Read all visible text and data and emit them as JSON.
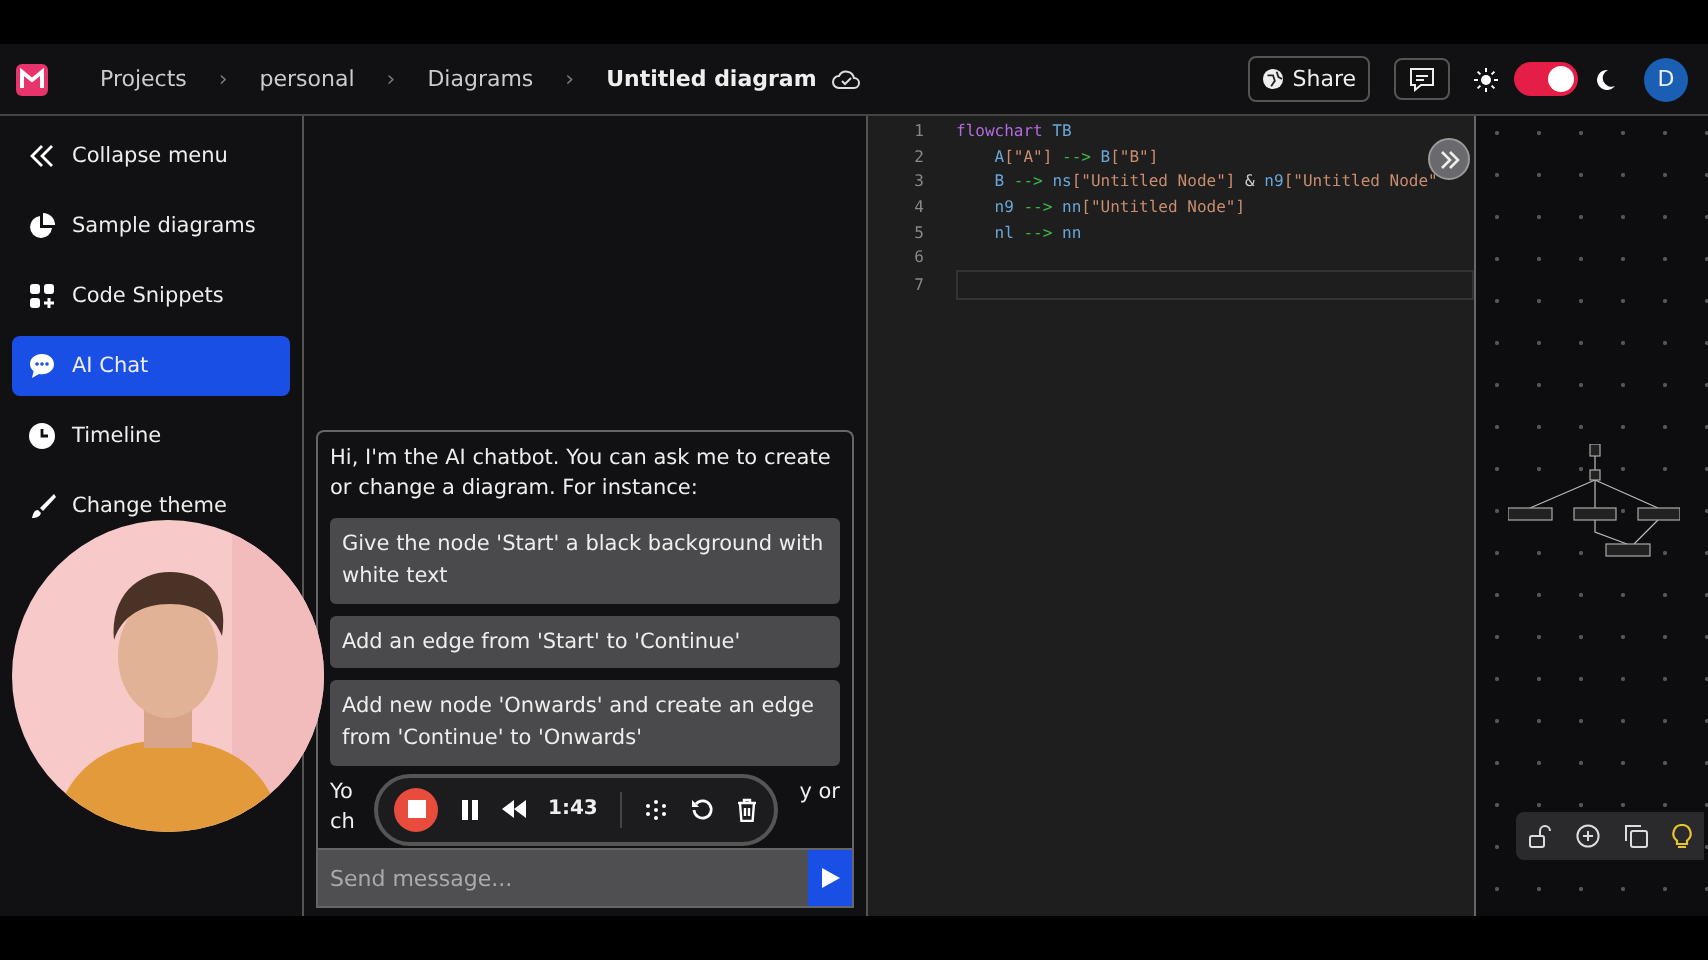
{
  "header": {
    "breadcrumbs": [
      "Projects",
      "personal",
      "Diagrams"
    ],
    "separator": "›",
    "title": "Untitled diagram",
    "share": "Share",
    "avatar": "D",
    "dark_mode": true
  },
  "sidebar": {
    "items": [
      {
        "label": "Collapse menu",
        "selected": false
      },
      {
        "label": "Sample diagrams",
        "selected": false
      },
      {
        "label": "Code Snippets",
        "selected": false
      },
      {
        "label": "AI Chat",
        "selected": true
      },
      {
        "label": "Timeline",
        "selected": false
      },
      {
        "label": "Change theme",
        "selected": false
      }
    ]
  },
  "chat": {
    "intro": "Hi, I'm the AI chatbot. You can ask me to create or change a diagram. For instance:",
    "suggestions": [
      "Give the node 'Start' a black background with white text",
      "Add an edge from 'Start' to 'Continue'",
      "Add new node 'Onwards' and create an edge from 'Continue' to 'Onwards'"
    ],
    "covered_text": [
      "Yo",
      "y or",
      "ch"
    ],
    "input": {
      "placeholder": "Send message..."
    }
  },
  "recorder": {
    "time": "1:43"
  },
  "editor": {
    "lines": [
      {
        "number": "1",
        "tokens": [
          {
            "text": "flowchart",
            "kind": "keyword"
          },
          {
            "text": " TB",
            "kind": "name"
          }
        ]
      },
      {
        "number": "2",
        "tokens": [
          {
            "text": "    A",
            "kind": "name"
          },
          {
            "text": "[\"A\"]",
            "kind": "string"
          },
          {
            "text": " --> ",
            "kind": "arrow"
          },
          {
            "text": "B",
            "kind": "name"
          },
          {
            "text": "[\"B\"]",
            "kind": "string"
          }
        ]
      },
      {
        "number": "3",
        "tokens": [
          {
            "text": "    B",
            "kind": "name"
          },
          {
            "text": " --> ",
            "kind": "arrow"
          },
          {
            "text": "ns",
            "kind": "name"
          },
          {
            "text": "[\"Untitled Node\"]",
            "kind": "string"
          },
          {
            "text": " & ",
            "kind": "plain"
          },
          {
            "text": "n9",
            "kind": "name"
          },
          {
            "text": "[\"Untitled Node\"",
            "kind": "string"
          }
        ]
      },
      {
        "number": "4",
        "tokens": [
          {
            "text": "    n9",
            "kind": "name"
          },
          {
            "text": " --> ",
            "kind": "arrow"
          },
          {
            "text": "nn",
            "kind": "name"
          },
          {
            "text": "[\"Untitled Node\"]",
            "kind": "string"
          }
        ]
      },
      {
        "number": "5",
        "tokens": [
          {
            "text": "    nl",
            "kind": "name"
          },
          {
            "text": " --> ",
            "kind": "arrow"
          },
          {
            "text": "nn",
            "kind": "name"
          }
        ]
      },
      {
        "number": "6"
      },
      {
        "number": "7"
      }
    ]
  }
}
